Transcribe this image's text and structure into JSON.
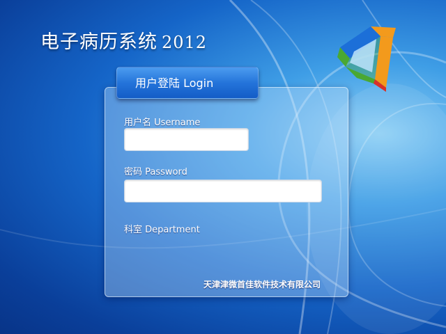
{
  "app": {
    "title": "电子病历系统",
    "version": "2012"
  },
  "login": {
    "tab_label": "用户登陆  Login",
    "username_label": "用户名  Username",
    "username_value": "",
    "password_label": "密码  Password",
    "password_value": "",
    "department_label": "科室  Department"
  },
  "footer": {
    "company": "天津津微首佳软件技术有限公司"
  },
  "icons": {
    "logo": "3d-frame-logo-icon"
  },
  "colors": {
    "background_dark": "#0a3f9a",
    "background_light": "#8fd0f5",
    "tab_blue": "#2474da",
    "logo_blue": "#1c6fd8",
    "logo_orange": "#f39a1c",
    "logo_green": "#4aa832",
    "logo_red": "#d8302a"
  }
}
